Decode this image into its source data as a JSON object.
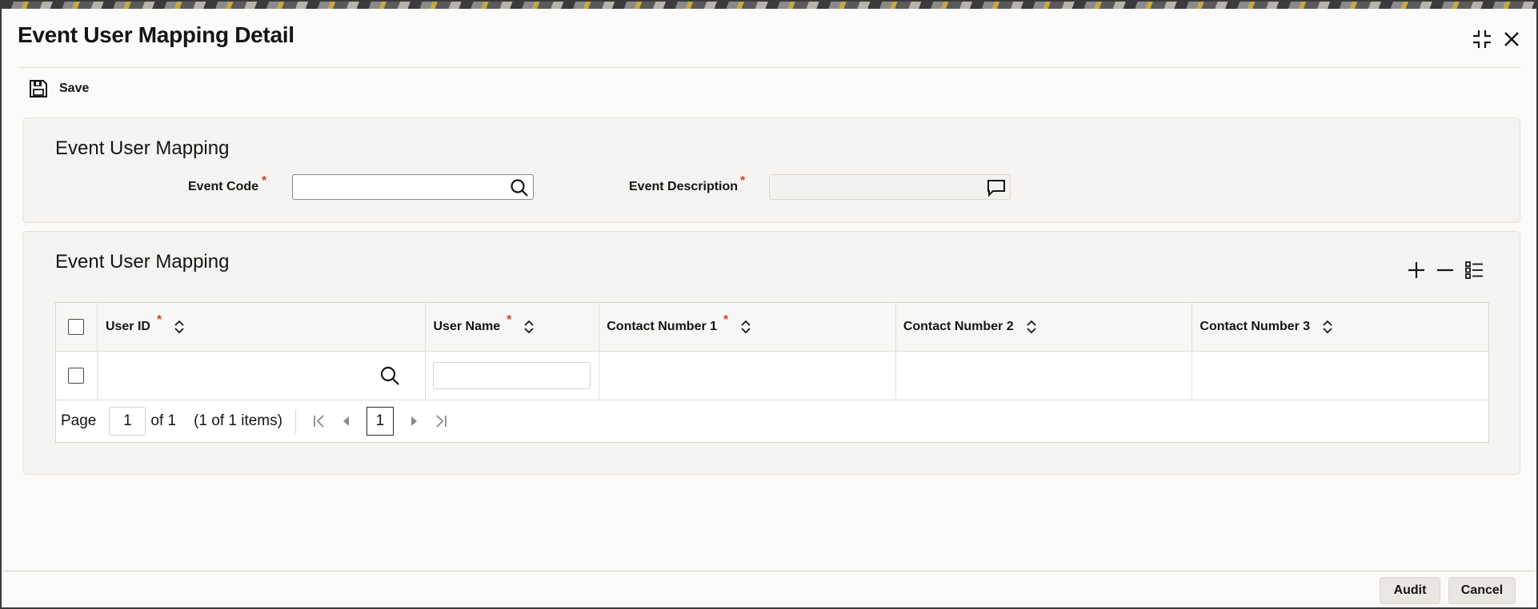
{
  "window": {
    "title": "Event User Mapping Detail",
    "minimize_icon": "collapse-icon",
    "close_icon": "close-icon"
  },
  "toolbar": {
    "save_label": "Save",
    "save_icon": "save-icon"
  },
  "header_section": {
    "title": "Event User Mapping",
    "fields": {
      "event_code": {
        "label": "Event Code",
        "required_mark": "*",
        "value": "",
        "icon": "search-icon"
      },
      "event_description": {
        "label": "Event Description",
        "required_mark": "*",
        "value": "",
        "icon": "comment-icon"
      }
    }
  },
  "grid_section": {
    "title": "Event User Mapping",
    "actions": [
      "add-icon",
      "remove-icon",
      "list-icon"
    ],
    "columns": [
      {
        "label": "User ID",
        "required_mark": "*"
      },
      {
        "label": "User Name",
        "required_mark": "*"
      },
      {
        "label": "Contact Number 1",
        "required_mark": "*"
      },
      {
        "label": "Contact Number 2",
        "required_mark": ""
      },
      {
        "label": "Contact Number 3",
        "required_mark": ""
      }
    ],
    "rows": [
      {
        "user_id": "",
        "user_name": "",
        "contact1": "",
        "contact2": "",
        "contact3": ""
      }
    ],
    "pager": {
      "page_label": "Page",
      "page_value": "1",
      "of_label": "of 1",
      "items_label": "(1 of 1 items)",
      "current_page": "1"
    }
  },
  "footer": {
    "audit_label": "Audit",
    "cancel_label": "Cancel"
  },
  "colors": {
    "required": "#c74634",
    "panel_bg": "#f6f4f2",
    "button_bg": "#eae7e3"
  }
}
